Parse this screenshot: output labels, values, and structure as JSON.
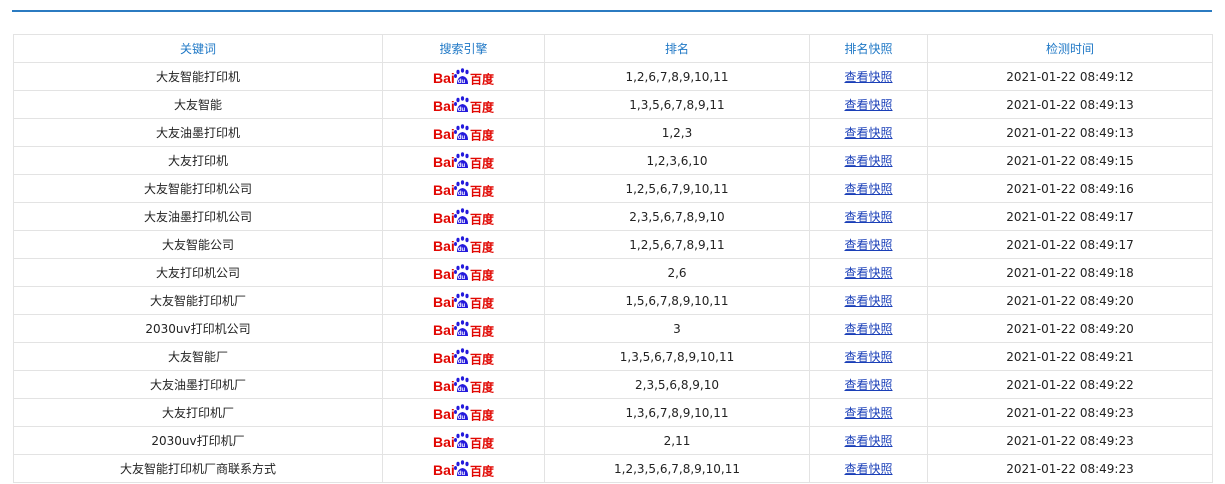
{
  "table": {
    "headers": [
      "关键词",
      "搜索引擎",
      "排名",
      "排名快照",
      "检测时间"
    ],
    "engine_icon": "baidu-logo-icon",
    "snapshot_label": "查看快照",
    "rows": [
      {
        "keyword": "大友智能打印机",
        "ranks": "1,2,6,7,8,9,10,11",
        "time": "2021-01-22 08:49:12"
      },
      {
        "keyword": "大友智能",
        "ranks": "1,3,5,6,7,8,9,11",
        "time": "2021-01-22 08:49:13"
      },
      {
        "keyword": "大友油墨打印机",
        "ranks": "1,2,3",
        "time": "2021-01-22 08:49:13"
      },
      {
        "keyword": "大友打印机",
        "ranks": "1,2,3,6,10",
        "time": "2021-01-22 08:49:15"
      },
      {
        "keyword": "大友智能打印机公司",
        "ranks": "1,2,5,6,7,9,10,11",
        "time": "2021-01-22 08:49:16"
      },
      {
        "keyword": "大友油墨打印机公司",
        "ranks": "2,3,5,6,7,8,9,10",
        "time": "2021-01-22 08:49:17"
      },
      {
        "keyword": "大友智能公司",
        "ranks": "1,2,5,6,7,8,9,11",
        "time": "2021-01-22 08:49:17"
      },
      {
        "keyword": "大友打印机公司",
        "ranks": "2,6",
        "time": "2021-01-22 08:49:18"
      },
      {
        "keyword": "大友智能打印机厂",
        "ranks": "1,5,6,7,8,9,10,11",
        "time": "2021-01-22 08:49:20"
      },
      {
        "keyword": "2030uv打印机公司",
        "ranks": "3",
        "time": "2021-01-22 08:49:20"
      },
      {
        "keyword": "大友智能厂",
        "ranks": "1,3,5,6,7,8,9,10,11",
        "time": "2021-01-22 08:49:21"
      },
      {
        "keyword": "大友油墨打印机厂",
        "ranks": "2,3,5,6,8,9,10",
        "time": "2021-01-22 08:49:22"
      },
      {
        "keyword": "大友打印机厂",
        "ranks": "1,3,6,7,8,9,10,11",
        "time": "2021-01-22 08:49:23"
      },
      {
        "keyword": "2030uv打印机厂",
        "ranks": "2,11",
        "time": "2021-01-22 08:49:23"
      },
      {
        "keyword": "大友智能打印机厂商联系方式",
        "ranks": "1,2,3,5,6,7,8,9,10,11",
        "time": "2021-01-22 08:49:23"
      }
    ]
  },
  "colors": {
    "accent": "#2b7bc1",
    "header_text": "#1f78c6",
    "link": "#1a3fb8",
    "baidu_red": "#e10601",
    "baidu_blue": "#2319dc"
  }
}
